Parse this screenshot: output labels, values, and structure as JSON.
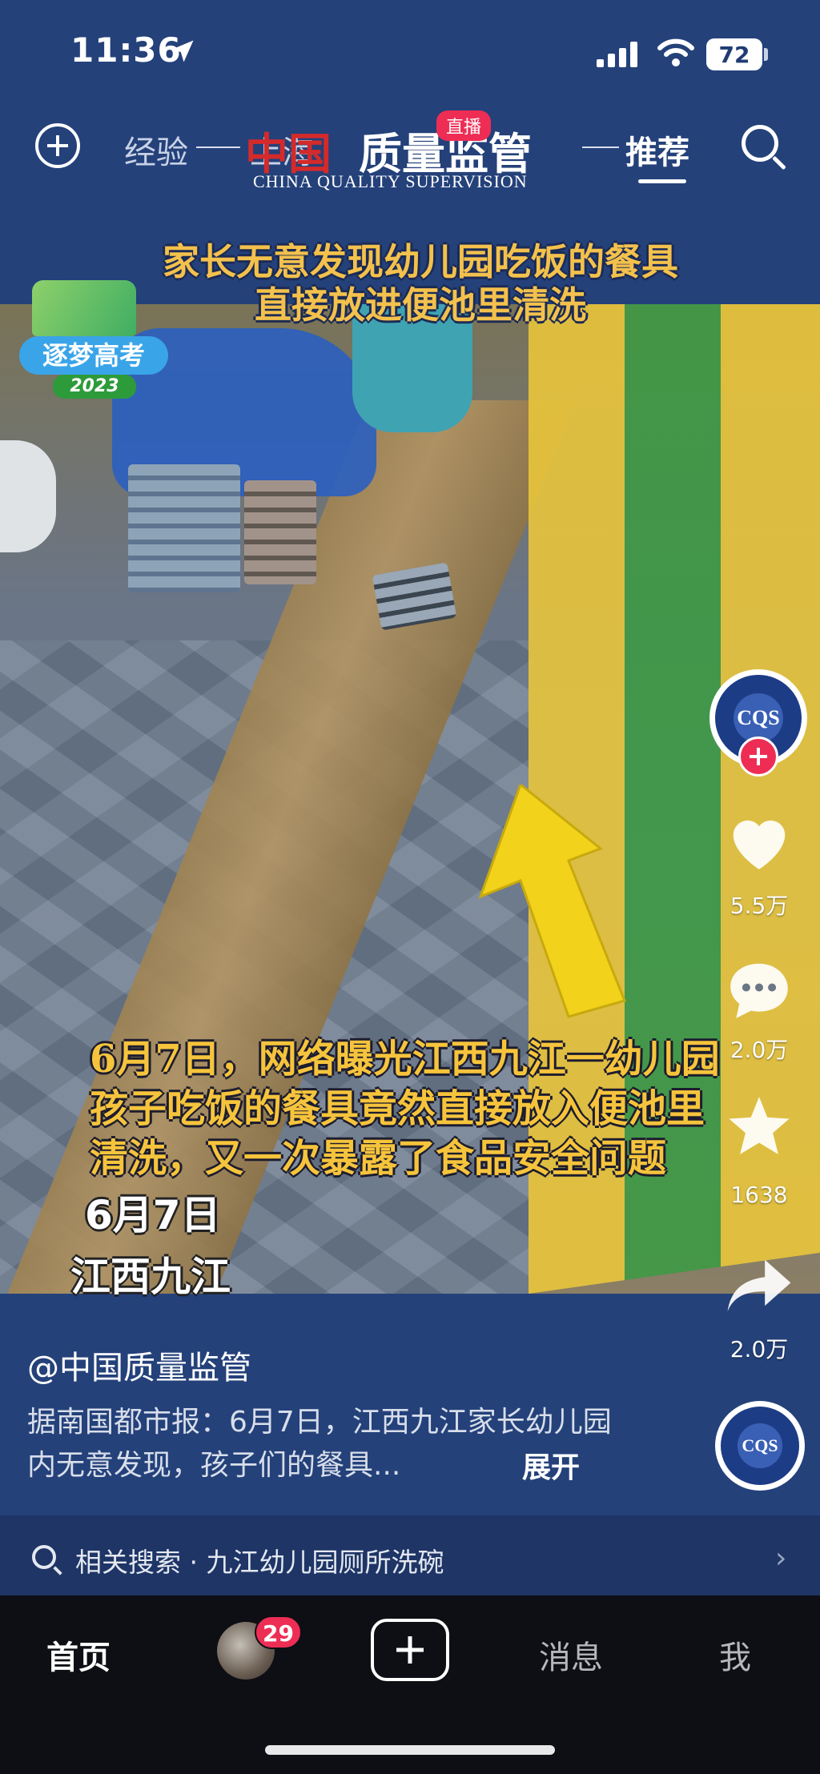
{
  "status_bar": {
    "time": "11:36",
    "battery": "72"
  },
  "top_nav": {
    "tabs": [
      "经验",
      "上海",
      "推荐"
    ],
    "active_tab": "推荐",
    "brand_red": "中国",
    "brand_cn": "质量监管",
    "brand_en": "CHINA QUALITY SUPERVISION",
    "live_badge": "直播"
  },
  "video": {
    "caption_top": [
      "家长无意发现幼儿园吃饭的餐具",
      "直接放进便池里清洗"
    ],
    "promo_title": "逐梦高考",
    "promo_year": "2023",
    "caption_bottom": [
      "6月7日，网络曝光江西九江一幼儿园",
      "孩子吃饭的餐具竟然直接放入便池里",
      "清洗，又一次暴露了食品安全问题"
    ],
    "overlay_date": "6月7日",
    "overlay_place": "江西九江"
  },
  "right_rail": {
    "avatar_label": "CQS",
    "likes": "5.5万",
    "comments": "2.0万",
    "favorites": "1638",
    "shares": "2.0万",
    "colors": {
      "follow": "#ee2d55",
      "heart": "#ffffff"
    }
  },
  "post": {
    "author": "@中国质量监管",
    "description": "据南国都市报：6月7日，江西九江家长幼儿园内无意发现，孩子们的餐具...",
    "expand_label": "展开"
  },
  "related_search": {
    "label": "相关搜索 · 九江幼儿园厕所洗碗"
  },
  "bottom_nav": {
    "home": "首页",
    "friends_badge": "29",
    "messages": "消息",
    "me": "我"
  },
  "icons": [
    "location-arrow-icon",
    "signal-icon",
    "wifi-icon",
    "plus-icon",
    "search-icon",
    "heart-icon",
    "comment-icon",
    "star-icon",
    "share-icon",
    "chevron-right-icon",
    "create-plus-icon"
  ]
}
